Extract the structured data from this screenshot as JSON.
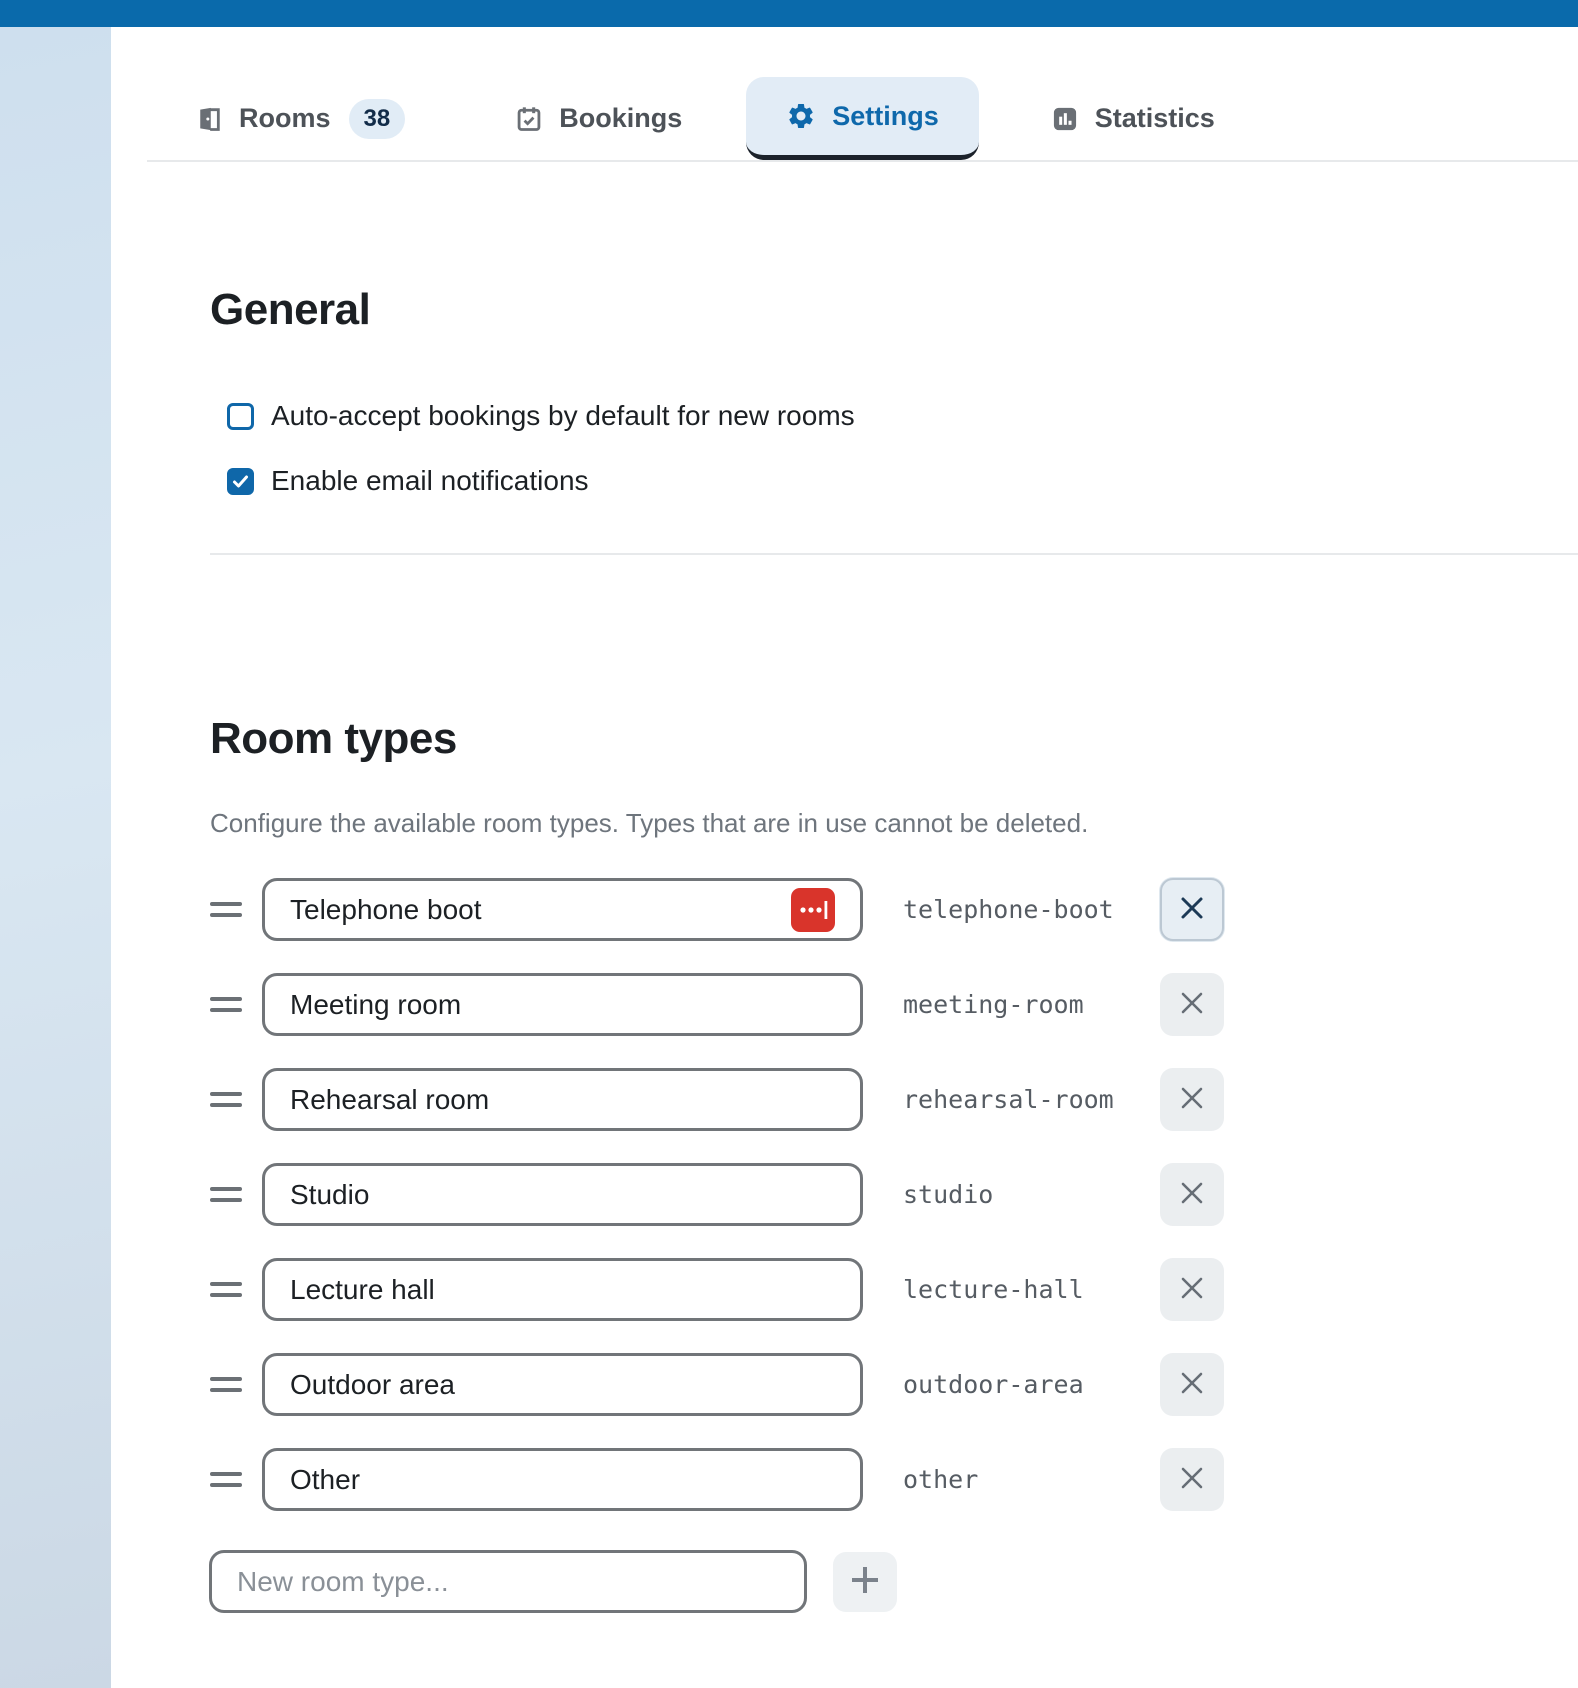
{
  "tabs": [
    {
      "label": "Rooms",
      "icon": "door-icon",
      "badge": "38",
      "active": false
    },
    {
      "label": "Bookings",
      "icon": "calendar-check-icon",
      "active": false
    },
    {
      "label": "Settings",
      "icon": "gear-icon",
      "active": true
    },
    {
      "label": "Statistics",
      "icon": "bar-chart-icon",
      "active": false
    }
  ],
  "general": {
    "heading": "General",
    "checkboxes": [
      {
        "label": "Auto-accept bookings by default for new rooms",
        "checked": false
      },
      {
        "label": "Enable email notifications",
        "checked": true
      }
    ]
  },
  "room_types": {
    "heading": "Room types",
    "description": "Configure the available room types. Types that are in use cannot be deleted.",
    "rows": [
      {
        "name": "Telephone boot",
        "slug": "telephone-boot",
        "has_extension_icon": true,
        "delete_focused": true
      },
      {
        "name": "Meeting room",
        "slug": "meeting-room",
        "has_extension_icon": false,
        "delete_focused": false
      },
      {
        "name": "Rehearsal room",
        "slug": "rehearsal-room",
        "has_extension_icon": false,
        "delete_focused": false
      },
      {
        "name": "Studio",
        "slug": "studio",
        "has_extension_icon": false,
        "delete_focused": false
      },
      {
        "name": "Lecture hall",
        "slug": "lecture-hall",
        "has_extension_icon": false,
        "delete_focused": false
      },
      {
        "name": "Outdoor area",
        "slug": "outdoor-area",
        "has_extension_icon": false,
        "delete_focused": false
      },
      {
        "name": "Other",
        "slug": "other",
        "has_extension_icon": false,
        "delete_focused": false
      }
    ],
    "new_row": {
      "placeholder": "New room type..."
    }
  },
  "colors": {
    "topbar": "#0a6aab",
    "accent": "#0e68ab",
    "tab-bg": "#e2ecf6",
    "badge-bg": "#e1ecf6",
    "badge-text": "#122c49",
    "checkbox": "#0f67a9",
    "red": "#d9342b",
    "input-border": "#717579",
    "slug": "#565c63",
    "btn-bg": "#ebeef0"
  }
}
